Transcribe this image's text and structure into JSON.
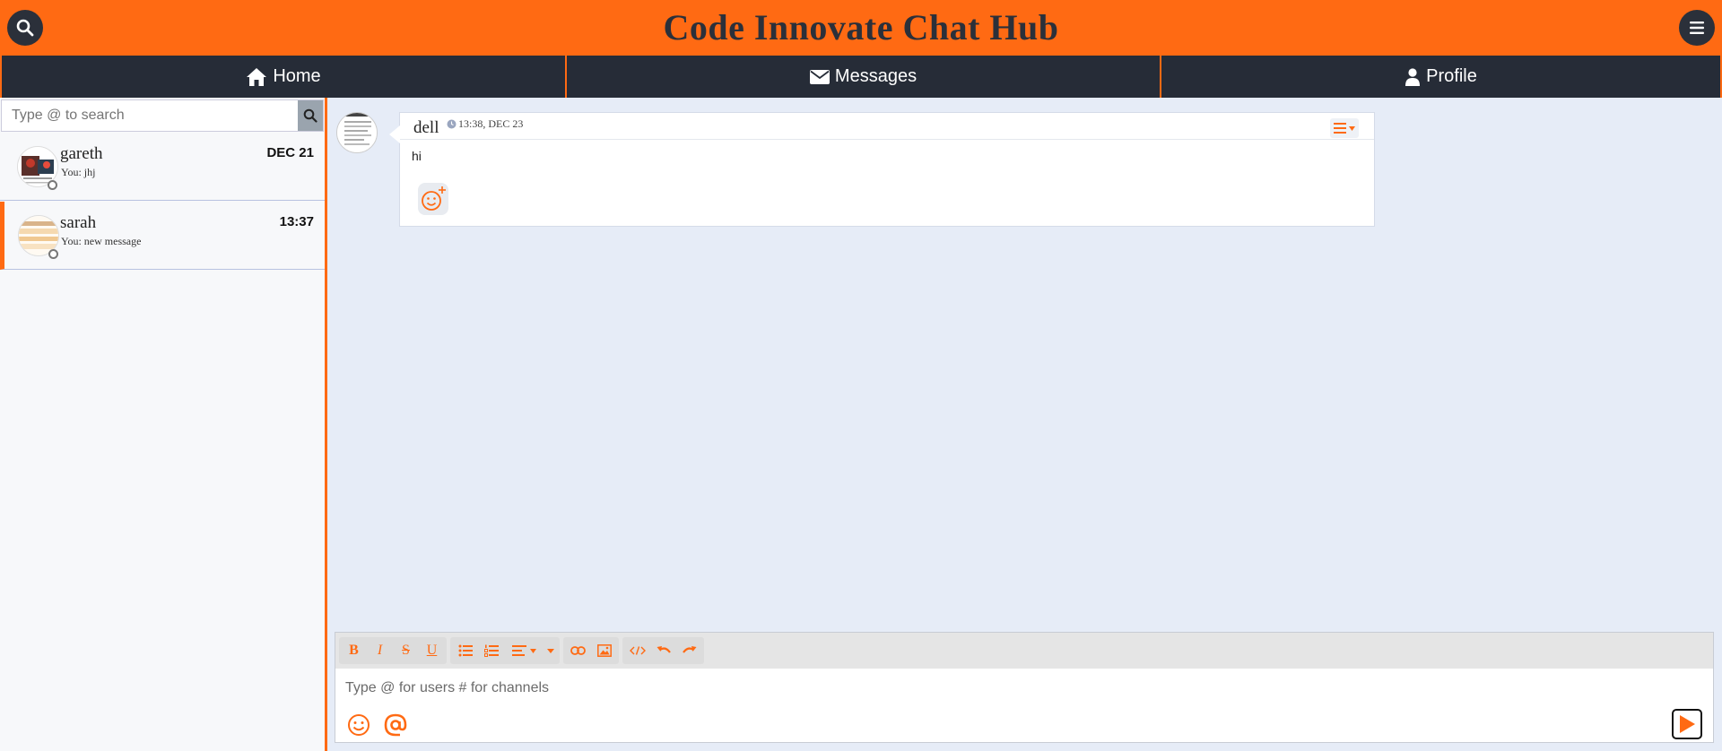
{
  "app": {
    "title": "Code Innovate Chat Hub"
  },
  "header": {
    "search_icon": "search-icon",
    "menu_icon": "hamburger-icon"
  },
  "nav": {
    "items": [
      {
        "label": "Home",
        "icon": "home-icon"
      },
      {
        "label": "Messages",
        "icon": "envelope-icon"
      },
      {
        "label": "Profile",
        "icon": "user-icon"
      }
    ]
  },
  "sidebar": {
    "search": {
      "placeholder": "Type @ to search",
      "value": ""
    },
    "conversations": [
      {
        "name": "gareth",
        "preview": "You: jhj",
        "date": "DEC 21",
        "status": "offline",
        "active": false
      },
      {
        "name": "sarah",
        "preview": "You: new message",
        "date": "13:37",
        "status": "offline",
        "active": true
      }
    ]
  },
  "messages": [
    {
      "author": "dell",
      "time": "13:38, DEC 23",
      "text": "hi"
    }
  ],
  "composer": {
    "toolbar": [
      "B",
      "I",
      "S",
      "U"
    ],
    "placeholder": "Type @ for users # for channels",
    "value": ""
  },
  "colors": {
    "accent": "#ff6a13",
    "dark": "#262c37",
    "background": "#e6ecf7"
  }
}
